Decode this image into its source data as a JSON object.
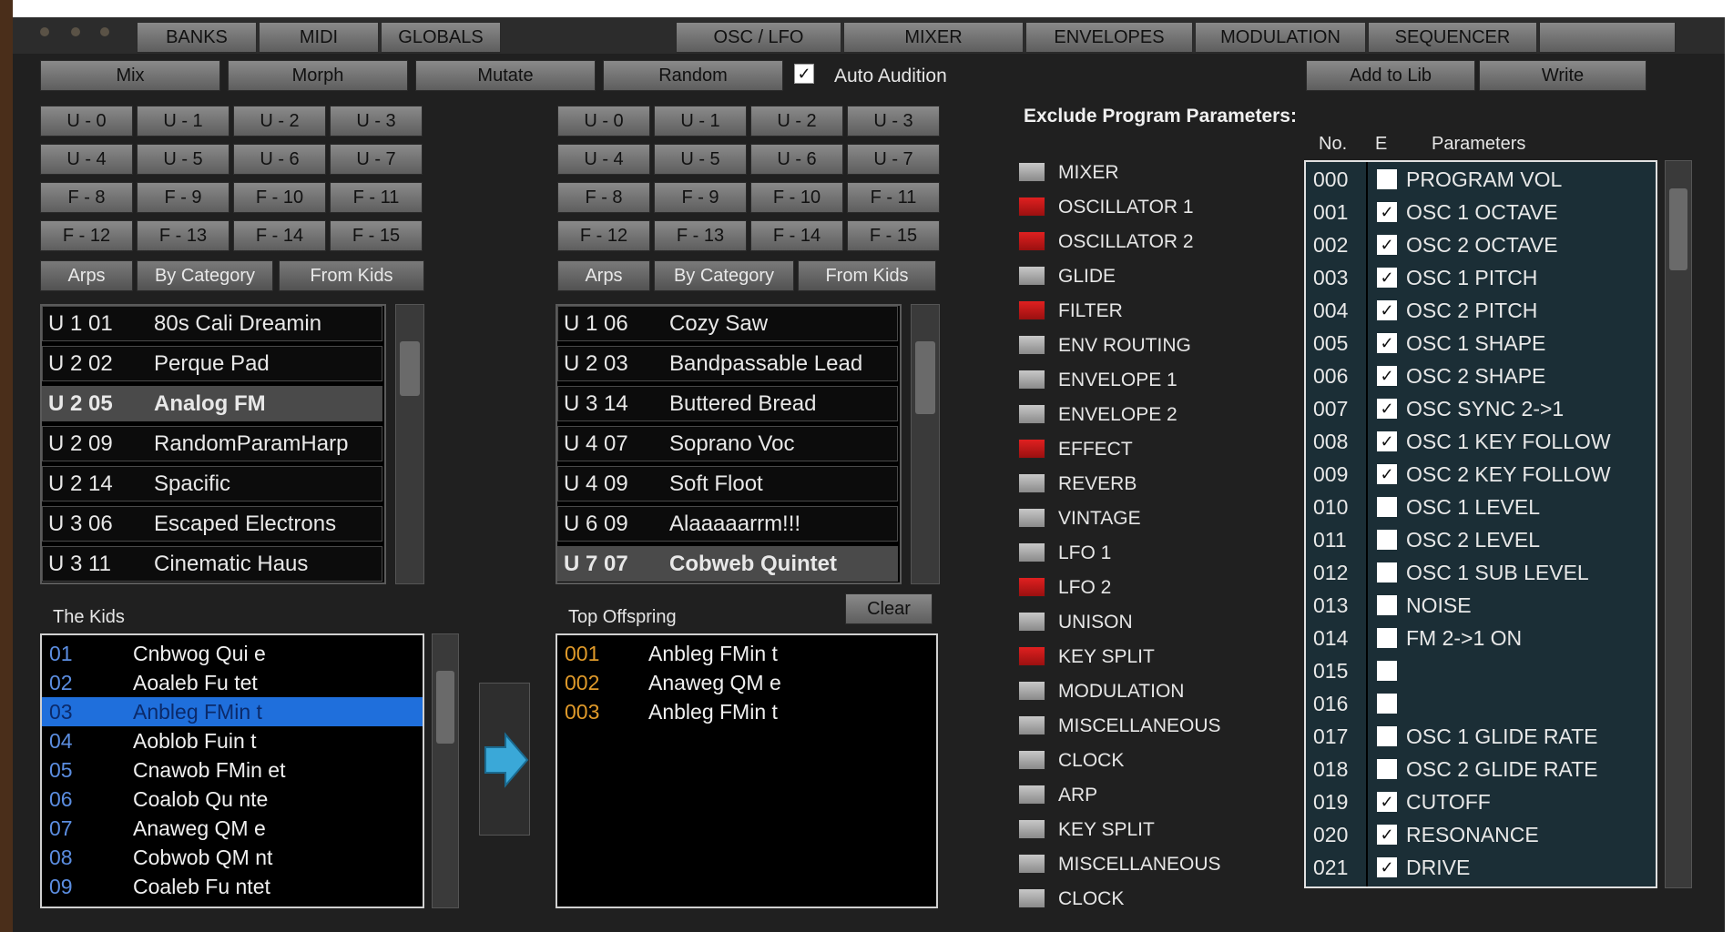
{
  "tabs": [
    "BANKS",
    "MIDI",
    "GLOBALS",
    "OSC / LFO",
    "MIXER",
    "ENVELOPES",
    "MODULATION",
    "SEQUENCER"
  ],
  "actions": {
    "mix": "Mix",
    "morph": "Morph",
    "mutate": "Mutate",
    "random": "Random",
    "add_to_lib": "Add to Lib",
    "write": "Write"
  },
  "auto_audition": {
    "label": "Auto Audition",
    "checked": true
  },
  "bank_buttons": [
    [
      "U - 0",
      "U - 1",
      "U - 2",
      "U - 3"
    ],
    [
      "U - 4",
      "U - 5",
      "U - 6",
      "U - 7"
    ],
    [
      "F - 8",
      "F - 9",
      "F - 10",
      "F - 11"
    ],
    [
      "F - 12",
      "F - 13",
      "F - 14",
      "F - 15"
    ]
  ],
  "filter_buttons": [
    "Arps",
    "By Category",
    "From Kids"
  ],
  "parent_a": [
    {
      "id": "U 1 01",
      "name": "80s Cali Dreamin"
    },
    {
      "id": "U 2 02",
      "name": "Perque Pad"
    },
    {
      "id": "U 2 05",
      "name": "Analog FM"
    },
    {
      "id": "U 2 09",
      "name": "RandomParamHarp"
    },
    {
      "id": "U 2 14",
      "name": "Spacific"
    },
    {
      "id": "U 3 06",
      "name": "Escaped Electrons"
    },
    {
      "id": "U 3 11",
      "name": "Cinematic Haus"
    }
  ],
  "parent_b": [
    {
      "id": "U 1 06",
      "name": "Cozy Saw"
    },
    {
      "id": "U 2 03",
      "name": "Bandpassable Lead"
    },
    {
      "id": "U 3 14",
      "name": "Buttered Bread"
    },
    {
      "id": "U 4 07",
      "name": "Soprano Voc"
    },
    {
      "id": "U 4 09",
      "name": "Soft  Floot"
    },
    {
      "id": "U 6 09",
      "name": "Alaaaaarrm!!!"
    },
    {
      "id": "U 7 07",
      "name": "Cobweb Quintet"
    }
  ],
  "kids": {
    "label": "The Kids",
    "items": [
      {
        "n": "01",
        "t": "Cnbwog Qui  e"
      },
      {
        "n": "02",
        "t": "Aoaleb Fu  tet"
      },
      {
        "n": "03",
        "t": "Anbleg FMin  t"
      },
      {
        "n": "04",
        "t": "Aoblob Fuin  t"
      },
      {
        "n": "05",
        "t": "Cnawob FMin et"
      },
      {
        "n": "06",
        "t": "Coalob Qu nte"
      },
      {
        "n": "07",
        "t": "Anaweg QM   e"
      },
      {
        "n": "08",
        "t": "Cobwob QM nt"
      },
      {
        "n": "09",
        "t": "Coaleb Fu ntet"
      }
    ]
  },
  "offspring": {
    "label": "Top Offspring",
    "clear": "Clear",
    "items": [
      {
        "n": "001",
        "t": "Anbleg FMin  t"
      },
      {
        "n": "002",
        "t": "Anaweg QM   e"
      },
      {
        "n": "003",
        "t": "Anbleg FMin  t"
      }
    ]
  },
  "exclude": {
    "title": "Exclude Program Parameters:",
    "groups": [
      {
        "label": "MIXER",
        "on": false
      },
      {
        "label": "OSCILLATOR 1",
        "on": true
      },
      {
        "label": "OSCILLATOR 2",
        "on": true
      },
      {
        "label": "GLIDE",
        "on": false
      },
      {
        "label": "FILTER",
        "on": true
      },
      {
        "label": "ENV ROUTING",
        "on": false
      },
      {
        "label": "ENVELOPE 1",
        "on": false
      },
      {
        "label": "ENVELOPE 2",
        "on": false
      },
      {
        "label": "EFFECT",
        "on": true
      },
      {
        "label": "REVERB",
        "on": false
      },
      {
        "label": "VINTAGE",
        "on": false
      },
      {
        "label": "LFO 1",
        "on": false
      },
      {
        "label": "LFO 2",
        "on": true
      },
      {
        "label": "UNISON",
        "on": false
      },
      {
        "label": "KEY SPLIT",
        "on": true
      },
      {
        "label": "MODULATION",
        "on": false
      },
      {
        "label": "MISCELLANEOUS",
        "on": false
      },
      {
        "label": "CLOCK",
        "on": false
      },
      {
        "label": "ARP",
        "on": false
      },
      {
        "label": "KEY SPLIT",
        "on": false
      },
      {
        "label": "MISCELLANEOUS",
        "on": false
      },
      {
        "label": "CLOCK",
        "on": false
      }
    ]
  },
  "params": {
    "headers": {
      "no": "No.",
      "e": "E",
      "name": "Parameters"
    },
    "rows": [
      {
        "no": "000",
        "e": false,
        "name": "PROGRAM VOL"
      },
      {
        "no": "001",
        "e": true,
        "name": "OSC 1 OCTAVE"
      },
      {
        "no": "002",
        "e": true,
        "name": "OSC 2 OCTAVE"
      },
      {
        "no": "003",
        "e": true,
        "name": "OSC 1 PITCH"
      },
      {
        "no": "004",
        "e": true,
        "name": "OSC 2 PITCH"
      },
      {
        "no": "005",
        "e": true,
        "name": "OSC 1 SHAPE"
      },
      {
        "no": "006",
        "e": true,
        "name": "OSC 2 SHAPE"
      },
      {
        "no": "007",
        "e": true,
        "name": "OSC SYNC 2->1"
      },
      {
        "no": "008",
        "e": true,
        "name": "OSC 1 KEY FOLLOW"
      },
      {
        "no": "009",
        "e": true,
        "name": "OSC 2 KEY FOLLOW"
      },
      {
        "no": "010",
        "e": false,
        "name": "OSC 1 LEVEL"
      },
      {
        "no": "011",
        "e": false,
        "name": "OSC 2 LEVEL"
      },
      {
        "no": "012",
        "e": false,
        "name": "OSC 1 SUB LEVEL"
      },
      {
        "no": "013",
        "e": false,
        "name": "NOISE"
      },
      {
        "no": "014",
        "e": false,
        "name": "FM 2->1 ON"
      },
      {
        "no": "015",
        "e": false,
        "name": ""
      },
      {
        "no": "016",
        "e": false,
        "name": ""
      },
      {
        "no": "017",
        "e": false,
        "name": "OSC 1 GLIDE RATE"
      },
      {
        "no": "018",
        "e": false,
        "name": "OSC 2 GLIDE RATE"
      },
      {
        "no": "019",
        "e": true,
        "name": "CUTOFF"
      },
      {
        "no": "020",
        "e": true,
        "name": "RESONANCE"
      },
      {
        "no": "021",
        "e": true,
        "name": "DRIVE"
      }
    ]
  },
  "colors": {
    "accent_blue": "#1f6fdc",
    "led_on": "#d01818",
    "panel": "#1b2e36"
  }
}
